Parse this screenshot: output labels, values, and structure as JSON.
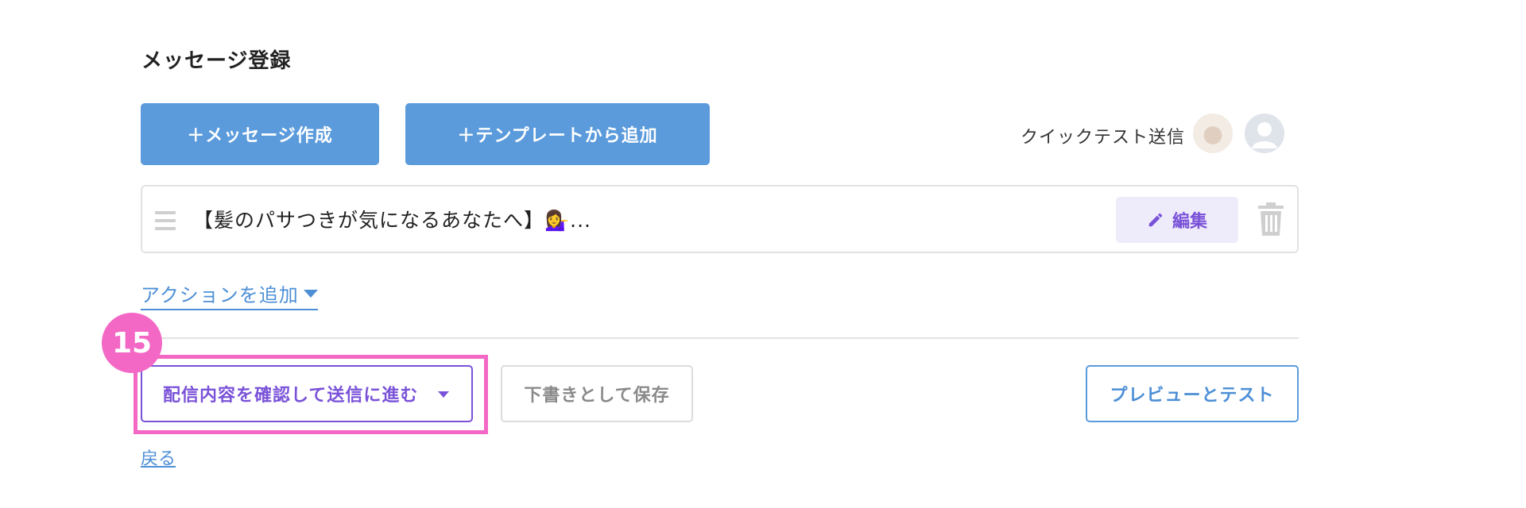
{
  "section_title": "メッセージ登録",
  "toolbar": {
    "create_message_label": "＋メッセージ作成",
    "add_from_template_label": "＋テンプレートから追加",
    "quick_test_label": "クイックテスト送信"
  },
  "message_item": {
    "text": "【髪のパサつきが気になるあなたへ】💁‍♀️...",
    "edit_label": "編集"
  },
  "action_link_label": "アクションを追加",
  "step_badge": "15",
  "buttons": {
    "confirm_send_label": "配信内容を確認して送信に進む",
    "save_draft_label": "下書きとして保存",
    "preview_test_label": "プレビューとテスト"
  },
  "back_link_label": "戻る",
  "colors": {
    "primary_blue": "#5b9bdc",
    "purple": "#7a52d8",
    "highlight_pink": "#f368c5"
  }
}
